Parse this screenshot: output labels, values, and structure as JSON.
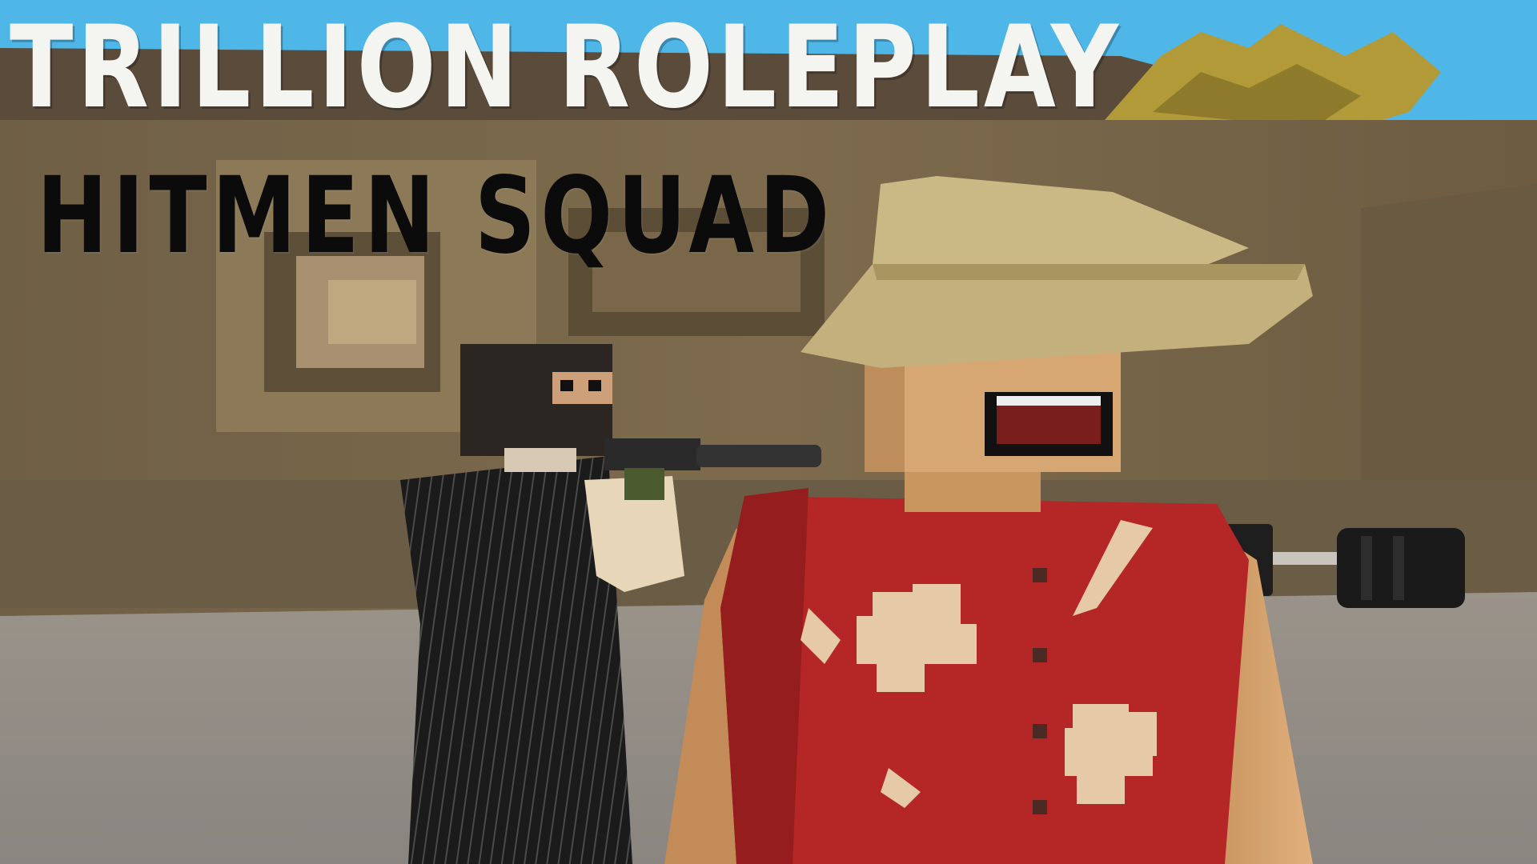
{
  "thumbnail": {
    "title_line_1": "TRILLION ROLEPLAY",
    "title_line_2": "HITMEN SQUAD"
  },
  "characters": [
    {
      "name": "masked-hitman",
      "outfit": "black pinstripe suit and balaclava",
      "holding": "silenced pistol"
    },
    {
      "name": "tourist",
      "outfit": "straw hat and red hawaiian shirt",
      "expression": "open-mouth grin"
    }
  ],
  "colors": {
    "title_main": "#f4f4f0",
    "title_sub": "#0b0b0b",
    "wall": "#7c6a4c",
    "ground": "#8e8a86",
    "sky": "#4fb6e8",
    "shirt": "#b92a2a",
    "skin": "#d9a873",
    "hat": "#c9b682",
    "suit": "#1c1c1c"
  }
}
